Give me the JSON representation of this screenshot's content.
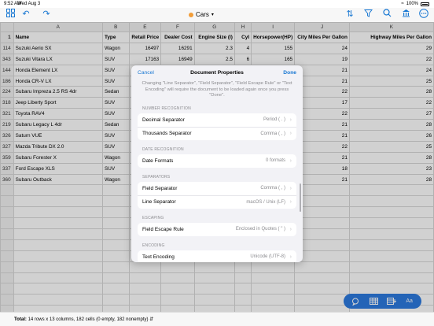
{
  "status_bar": {
    "time": "9:52 AM",
    "date": "Wed Aug 3",
    "battery": "100%"
  },
  "toolbar": {
    "title": "Cars",
    "title_dot_color": "#f29d38",
    "left_icons": [
      "grid-icon",
      "undo-icon",
      "redo-icon"
    ],
    "right_icons": [
      "sort-icon",
      "filter-icon",
      "search-icon",
      "columns-icon",
      "more-icon"
    ]
  },
  "sheet": {
    "column_letters": [
      "",
      "A",
      "B",
      "E",
      "F",
      "G",
      "H",
      "I",
      "J",
      "K"
    ],
    "header_row_num": "1",
    "headers": [
      "Name",
      "Type",
      "Retail Price",
      "Dealer Cost",
      "Engine Size (l)",
      "Cyl",
      "Horsepower(HP)",
      "City Miles Per Gallon",
      "Highway Miles Per Gallon"
    ],
    "rows": [
      {
        "num": "114",
        "cells": [
          "Suzuki Aerio SX",
          "Wagon",
          "16497",
          "16291",
          "2.3",
          "4",
          "155",
          "24",
          "29"
        ]
      },
      {
        "num": "343",
        "cells": [
          "Suzuki Vitara LX",
          "SUV",
          "17163",
          "16949",
          "2.5",
          "6",
          "165",
          "19",
          "22"
        ]
      },
      {
        "num": "144",
        "cells": [
          "Honda Element LX",
          "SUV",
          "",
          "",
          "",
          "",
          "60",
          "21",
          "24"
        ]
      },
      {
        "num": "186",
        "cells": [
          "Honda CR-V LX",
          "SUV",
          "",
          "",
          "",
          "",
          "60",
          "21",
          "25"
        ]
      },
      {
        "num": "224",
        "cells": [
          "Subaru Impreza 2.5 RS 4dr",
          "Sedan",
          "",
          "",
          "",
          "",
          "65",
          "22",
          "28"
        ]
      },
      {
        "num": "318",
        "cells": [
          "Jeep Liberty Sport",
          "SUV",
          "",
          "",
          "",
          "",
          "10",
          "17",
          "22"
        ]
      },
      {
        "num": "321",
        "cells": [
          "Toyota RAV4",
          "SUV",
          "",
          "",
          "",
          "",
          "61",
          "22",
          "27"
        ]
      },
      {
        "num": "219",
        "cells": [
          "Subaru Legacy L 4dr",
          "Sedan",
          "",
          "",
          "",
          "",
          "65",
          "21",
          "28"
        ]
      },
      {
        "num": "326",
        "cells": [
          "Saturn VUE",
          "SUV",
          "",
          "",
          "",
          "",
          "43",
          "21",
          "26"
        ]
      },
      {
        "num": "327",
        "cells": [
          "Mazda Tribute DX 2.0",
          "SUV",
          "",
          "",
          "",
          "",
          "30",
          "22",
          "25"
        ]
      },
      {
        "num": "359",
        "cells": [
          "Subaru Forester X",
          "Wagon",
          "",
          "",
          "",
          "",
          "65",
          "21",
          "28"
        ]
      },
      {
        "num": "337",
        "cells": [
          "Ford Escape XLS",
          "SUV",
          "",
          "",
          "",
          "",
          "53",
          "18",
          "23"
        ]
      },
      {
        "num": "360",
        "cells": [
          "Subaru Outback",
          "Wagon",
          "",
          "",
          "",
          "",
          "65",
          "21",
          "28"
        ]
      }
    ]
  },
  "footer": {
    "total_label": "Total:",
    "total_text": "14 rows x 13 columns, 182 cells (0 empty, 182 nonempty)"
  },
  "fab": {
    "icons": [
      "comment-icon",
      "table-icon",
      "insert-table-icon",
      "text-format-icon"
    ],
    "text_label": "Aa"
  },
  "modal": {
    "cancel": "Cancel",
    "title": "Document Properties",
    "done": "Done",
    "note": "Changing \"Line Separator\", \"Field Separator\", \"Field Escape Rule\" or \"Text Encoding\" will require the document to be loaded again once you press \"Done\".",
    "sections": [
      {
        "label": "NUMBER RECOGNITION",
        "rows": [
          {
            "label": "Decimal Separator",
            "value": "Period ( . )"
          },
          {
            "label": "Thousands Separator",
            "value": "Comma ( , )"
          }
        ]
      },
      {
        "label": "DATE RECOGNITION",
        "rows": [
          {
            "label": "Date Formats",
            "value": "0 formats"
          }
        ]
      },
      {
        "label": "SEPARATORS",
        "rows": [
          {
            "label": "Field Separator",
            "value": "Comma ( , )"
          },
          {
            "label": "Line Separator",
            "value": "macOS / Unix (LF)"
          }
        ]
      },
      {
        "label": "ESCAPING",
        "rows": [
          {
            "label": "Field Escape Rule",
            "value": "Enclosed in Quotes ( \" )"
          }
        ]
      },
      {
        "label": "ENCODING",
        "rows": [
          {
            "label": "Text Encoding",
            "value": "Unicode (UTF-8)"
          }
        ]
      }
    ]
  }
}
